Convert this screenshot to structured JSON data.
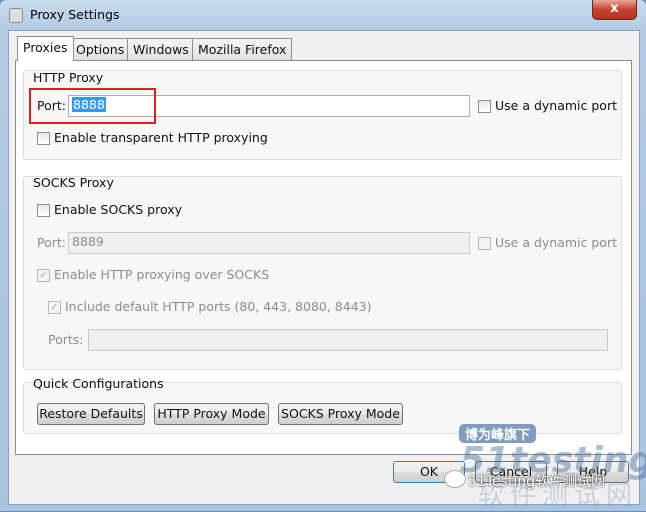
{
  "window": {
    "title": "Proxy Settings",
    "close_label": "x"
  },
  "tabs": [
    {
      "label": "Proxies",
      "active": true
    },
    {
      "label": "Options"
    },
    {
      "label": "Windows"
    },
    {
      "label": "Mozilla Firefox"
    }
  ],
  "http_proxy": {
    "label": "HTTP Proxy",
    "port_label": "Port:",
    "port_value": "8888",
    "dynamic_port_label": "Use a dynamic port",
    "dynamic_port_checked": false,
    "transparent_label": "Enable transparent HTTP proxying",
    "transparent_checked": false
  },
  "socks_proxy": {
    "label": "SOCKS Proxy",
    "enable_label": "Enable SOCKS proxy",
    "enable_checked": false,
    "port_label": "Port:",
    "port_value": "8889",
    "dynamic_port_label": "Use a dynamic port",
    "http_over_socks_label": "Enable HTTP proxying over SOCKS",
    "http_over_socks_checked": true,
    "include_default_label": "Include default HTTP ports (80, 443, 8080, 8443)",
    "include_default_checked": true,
    "ports_label": "Ports:",
    "ports_value": ""
  },
  "quick": {
    "label": "Quick Configurations",
    "buttons": [
      "Restore Defaults",
      "HTTP Proxy Mode",
      "SOCKS Proxy Mode"
    ]
  },
  "footer": {
    "ok": "OK",
    "cancel": "Cancel",
    "help": "Help"
  },
  "watermark": {
    "badge": "博为峰旗下",
    "logo": "51testing",
    "caption": "51Testing软件测试网",
    "big": "软件测试网"
  },
  "colors": {
    "highlight_box": "#e02020",
    "selection": "#3399ff"
  }
}
